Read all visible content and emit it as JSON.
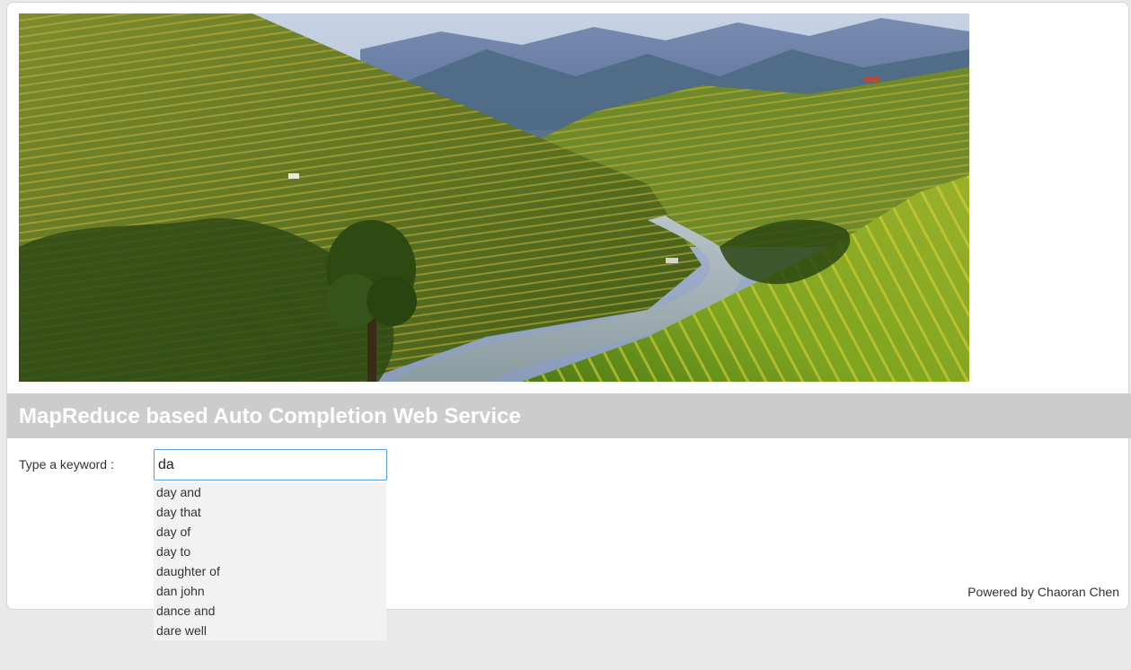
{
  "title": "MapReduce based Auto Completion Web Service",
  "form": {
    "label": "Type a keyword :",
    "value": "da"
  },
  "suggestions": [
    "day and",
    "day that",
    "day of",
    "day to",
    "daughter of",
    "dan john",
    "dance and",
    "dare well"
  ],
  "footer": {
    "credit": "Powered by Chaoran Chen"
  },
  "colors": {
    "title_bar": "#cccccc",
    "title_text": "#ffffff",
    "page_background": "#e9e9e9",
    "input_border": "#5c9fd6",
    "dropdown_background": "#f2f2f2"
  },
  "banner": {
    "subject": "terraced rice fields in a mountain valley with a river"
  }
}
